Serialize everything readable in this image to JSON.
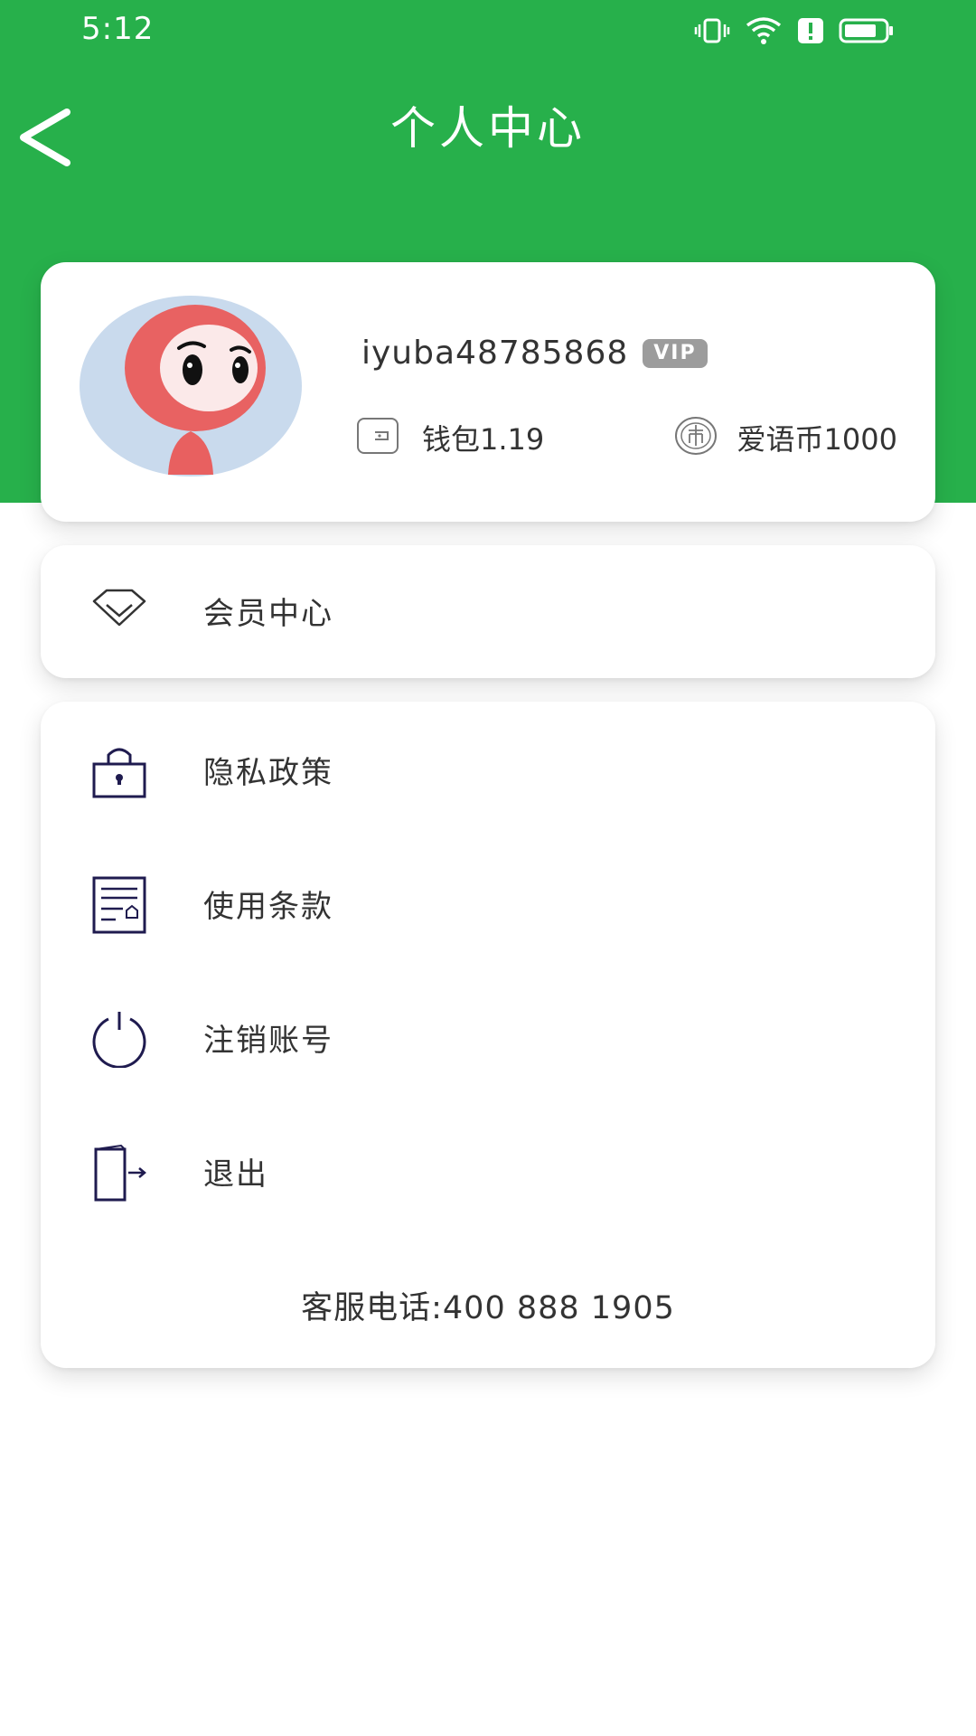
{
  "status_bar": {
    "time": "5:12",
    "icons": [
      "vibrate-icon",
      "wifi-icon",
      "alert-icon",
      "battery-icon"
    ]
  },
  "header": {
    "title": "个人中心",
    "back_icon": "chevron-left-icon"
  },
  "profile": {
    "username": "iyuba48785868",
    "vip_badge": "VIP",
    "wallet_label": "钱包1.19",
    "coins_label": "爱语币1000",
    "icons": [
      "avatar",
      "wallet-icon",
      "coin-icon"
    ]
  },
  "member_center": {
    "label": "会员中心",
    "icon": "diamond-icon"
  },
  "menu": {
    "items": [
      {
        "label": "隐私政策",
        "icon": "lock-icon"
      },
      {
        "label": "使用条款",
        "icon": "document-icon"
      },
      {
        "label": "注销账号",
        "icon": "power-icon"
      },
      {
        "label": "退出",
        "icon": "logout-icon"
      }
    ],
    "service_phone": "客服电话:400 888 1905"
  },
  "colors": {
    "brand_green": "#27b04b",
    "icon_navy": "#1f1b4f",
    "vip_gray": "#9c9c9c"
  }
}
